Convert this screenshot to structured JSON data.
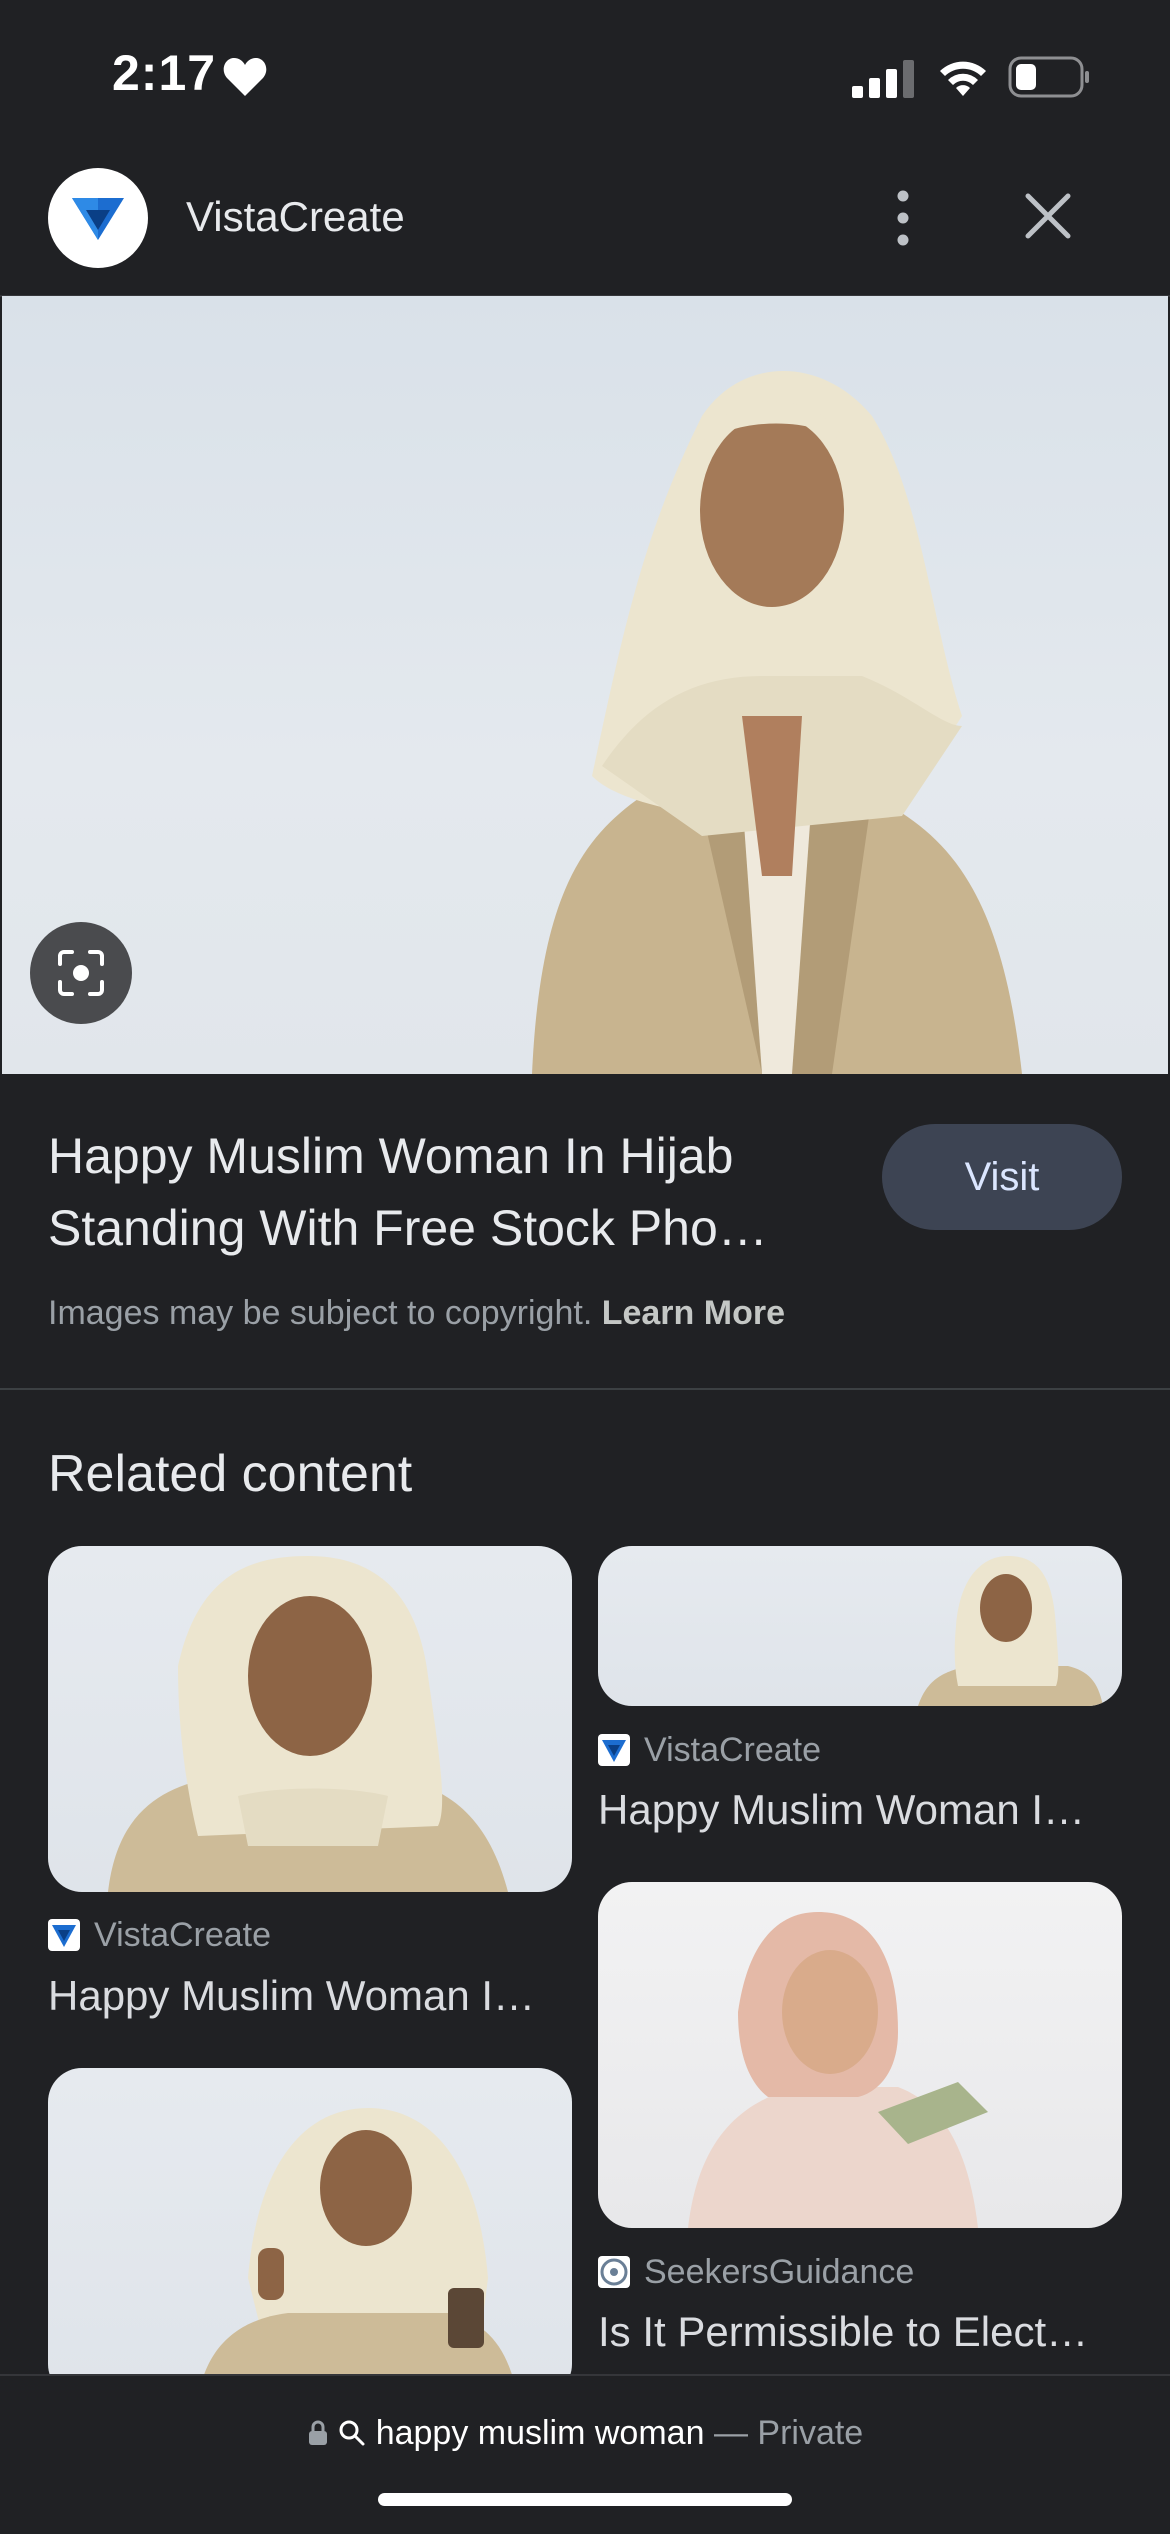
{
  "status_bar": {
    "time": "2:17",
    "icons": [
      "heart-icon",
      "signal-icon",
      "wifi-icon",
      "battery-icon"
    ]
  },
  "header": {
    "site_name": "VistaCreate",
    "logo_icon": "vistacreate-logo-icon",
    "menu_icon": "more-vert-icon",
    "close_icon": "close-icon"
  },
  "hero": {
    "image_description_icon": "lens-icon"
  },
  "result": {
    "title_line1": "Happy Muslim Woman In Hijab",
    "title_line2": "Standing With Free Stock Pho…",
    "visit_label": "Visit",
    "copyright_text": "Images may be subject to copyright.",
    "learn_more": "Learn More"
  },
  "related": {
    "heading": "Related content",
    "cards": [
      {
        "source": "VistaCreate",
        "title": "Happy Muslim Woman I…"
      },
      {
        "source": "VistaCreate",
        "title": "Happy Muslim Woman I…"
      },
      {
        "source": "SeekersGuidance",
        "title": "Is It Permissible to Elect…"
      },
      {
        "source": "",
        "title": ""
      }
    ]
  },
  "bottom_bar": {
    "query": "happy muslim woman",
    "separator": "—",
    "mode": "Private"
  },
  "colors": {
    "background": "#202124",
    "visit_button": "#3d4453",
    "vista_blue": "#2f7fd6"
  }
}
